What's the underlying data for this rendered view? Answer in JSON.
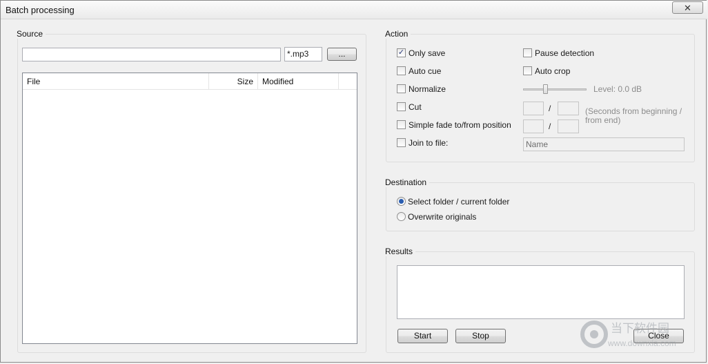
{
  "window": {
    "title": "Batch processing",
    "close_glyph": "✕"
  },
  "source": {
    "group_label": "Source",
    "path_value": "",
    "filter_value": "*.mp3",
    "browse_label": "...",
    "columns": [
      "File",
      "Size",
      "Modified"
    ],
    "rows": []
  },
  "action": {
    "group_label": "Action",
    "only_save": {
      "label": "Only save",
      "checked": true
    },
    "auto_cue": {
      "label": "Auto cue",
      "checked": false
    },
    "normalize": {
      "label": "Normalize",
      "checked": false
    },
    "cut": {
      "label": "Cut",
      "checked": false
    },
    "simple_fade": {
      "label": "Simple fade to/from position",
      "checked": false
    },
    "join_to_file": {
      "label": "Join to file:",
      "checked": false
    },
    "pause_detection": {
      "label": "Pause detection",
      "checked": false
    },
    "auto_crop": {
      "label": "Auto crop",
      "checked": false
    },
    "level_label": "Level: 0.0 dB",
    "level_fraction": 0.35,
    "slash": "/",
    "seconds_hint_line1": "(Seconds from beginning /",
    "seconds_hint_line2": "from end)",
    "name_placeholder": "Name"
  },
  "destination": {
    "group_label": "Destination",
    "options": [
      {
        "label": "Select folder / current folder",
        "selected": true
      },
      {
        "label": "Overwrite originals",
        "selected": false
      }
    ]
  },
  "results": {
    "group_label": "Results",
    "text": "",
    "start_label": "Start",
    "stop_label": "Stop",
    "close_label": "Close"
  },
  "watermark": {
    "text_cn": "当下软件园",
    "url": "www.downxia.com"
  }
}
